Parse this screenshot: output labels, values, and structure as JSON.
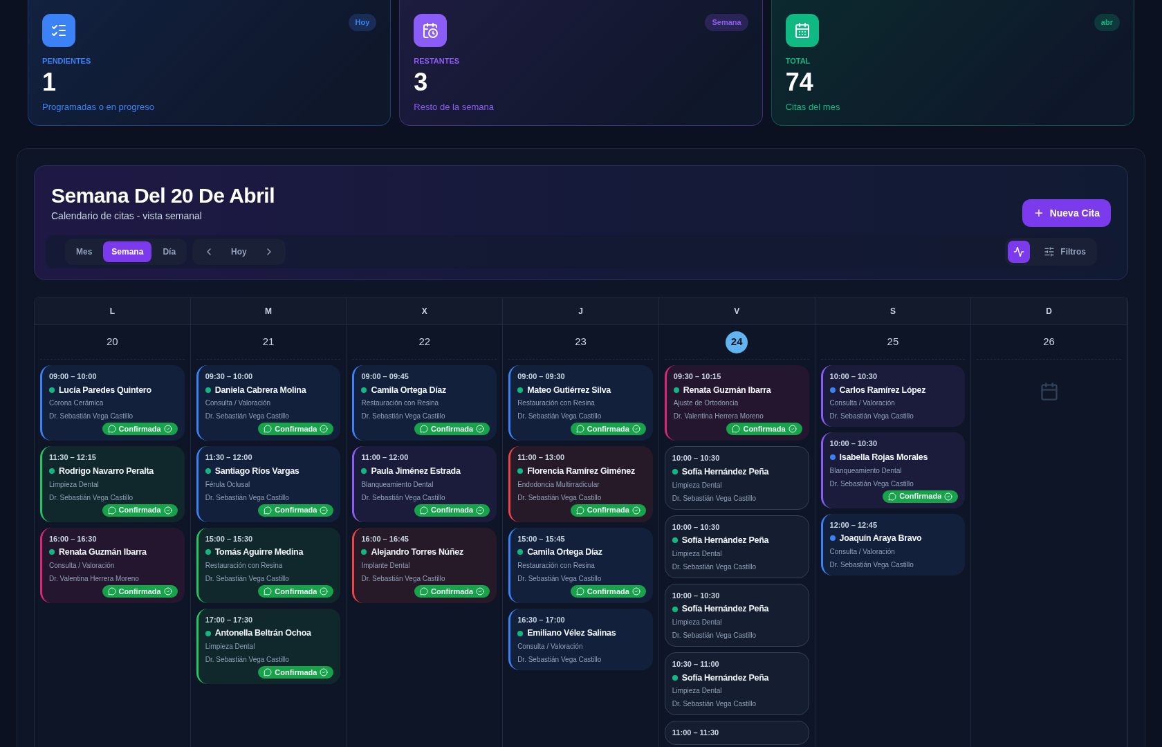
{
  "stats": [
    {
      "kind": "list",
      "badge": "Hoy",
      "label": "PENDIENTES",
      "value": "1",
      "caption": "Programadas o en progreso",
      "color": "#3b82f6"
    },
    {
      "kind": "clock",
      "badge": "Semana",
      "label": "RESTANTES",
      "value": "3",
      "caption": "Resto de la semana",
      "color": "#8b5cf6"
    },
    {
      "kind": "calendar",
      "badge": "abr",
      "label": "TOTAL",
      "value": "74",
      "caption": "Citas del mes",
      "color": "#10b981"
    }
  ],
  "header": {
    "title": "Semana Del 20 De Abril",
    "subtitle": "Calendario de citas - vista semanal",
    "new_button": "Nueva Cita",
    "views": [
      {
        "label": "Mes",
        "selected": false
      },
      {
        "label": "Semana",
        "selected": true
      },
      {
        "label": "Día",
        "selected": false
      }
    ],
    "today_button": "Hoy",
    "activity_on": true,
    "filters": "Filtros"
  },
  "days": [
    {
      "letter": "L",
      "date": "20",
      "selected": false,
      "appointments": [
        {
          "kind": "blue",
          "color": "#10b981",
          "time": "09:00 – 10:00",
          "patient": "Lucía Paredes Quintero",
          "treatment": "Corona Cerámica",
          "doctor": "Dr. Sebastián Vega Castillo",
          "status": "Confirmada"
        },
        {
          "kind": "green",
          "color": "#10b981",
          "time": "11:30 – 12:15",
          "patient": "Rodrigo Navarro Peralta",
          "treatment": "Limpieza Dental",
          "doctor": "Dr. Sebastián Vega Castillo",
          "status": "Confirmada"
        },
        {
          "kind": "pink",
          "color": "#10b981",
          "time": "16:00 – 16:30",
          "patient": "Renata Guzmán Ibarra",
          "treatment": "Consulta / Valoración",
          "doctor": "Dr. Valentina Herrera Moreno",
          "status": "Confirmada"
        }
      ]
    },
    {
      "letter": "M",
      "date": "21",
      "selected": false,
      "appointments": [
        {
          "kind": "blue",
          "color": "#10b981",
          "time": "09:30 – 10:00",
          "patient": "Daniela Cabrera Molina",
          "treatment": "Consulta / Valoración",
          "doctor": "Dr. Sebastián Vega Castillo",
          "status": "Confirmada"
        },
        {
          "kind": "blue",
          "color": "#10b981",
          "time": "11:30 – 12:00",
          "patient": "Santiago Ríos Vargas",
          "treatment": "Férula Oclusal",
          "doctor": "Dr. Sebastián Vega Castillo",
          "status": "Confirmada"
        },
        {
          "kind": "green",
          "color": "#10b981",
          "time": "15:00 – 15:30",
          "patient": "Tomás Aguirre Medina",
          "treatment": "Restauración con Resina",
          "doctor": "Dr. Sebastián Vega Castillo",
          "status": "Confirmada"
        },
        {
          "kind": "green",
          "color": "#10b981",
          "time": "17:00 – 17:30",
          "patient": "Antonella Beltrán Ochoa",
          "treatment": "Limpieza Dental",
          "doctor": "Dr. Sebastián Vega Castillo",
          "status": "Confirmada"
        }
      ]
    },
    {
      "letter": "X",
      "date": "22",
      "selected": false,
      "appointments": [
        {
          "kind": "blue",
          "color": "#10b981",
          "time": "09:00 – 09:45",
          "patient": "Camila Ortega Díaz",
          "treatment": "Restauración con Resina",
          "doctor": "Dr. Sebastián Vega Castillo",
          "status": "Confirmada"
        },
        {
          "kind": "purple",
          "color": "#10b981",
          "time": "11:00 – 12:00",
          "patient": "Paula Jiménez Estrada",
          "treatment": "Blanqueamiento Dental",
          "doctor": "Dr. Sebastián Vega Castillo",
          "status": "Confirmada"
        },
        {
          "kind": "red",
          "color": "#10b981",
          "time": "16:00 – 16:45",
          "patient": "Alejandro Torres Núñez",
          "treatment": "Implante Dental",
          "doctor": "Dr. Sebastián Vega Castillo",
          "status": "Confirmada"
        }
      ]
    },
    {
      "letter": "J",
      "date": "23",
      "selected": false,
      "appointments": [
        {
          "kind": "blue",
          "color": "#10b981",
          "time": "09:00 – 09:30",
          "patient": "Mateo Gutiérrez Silva",
          "treatment": "Restauración con Resina",
          "doctor": "Dr. Sebastián Vega Castillo",
          "status": "Confirmada"
        },
        {
          "kind": "red",
          "color": "#10b981",
          "time": "11:00 – 13:00",
          "patient": "Florencia Ramírez Giménez",
          "treatment": "Endodoncia Multirradicular",
          "doctor": "Dr. Sebastián Vega Castillo",
          "status": "Confirmada"
        },
        {
          "kind": "blue",
          "color": "#10b981",
          "time": "15:00 – 15:45",
          "patient": "Camila Ortega Díaz",
          "treatment": "Restauración con Resina",
          "doctor": "Dr. Sebastián Vega Castillo",
          "status": "Confirmada"
        },
        {
          "kind": "blue",
          "color": "#10b981",
          "time": "16:30 – 17:00",
          "patient": "Emiliano Vélez Salinas",
          "treatment": "Consulta / Valoración",
          "doctor": "Dr. Sebastián Vega Castillo"
        }
      ]
    },
    {
      "letter": "V",
      "date": "24",
      "selected": true,
      "appointments": [
        {
          "kind": "pink",
          "color": "#10b981",
          "time": "09:30 – 10:15",
          "patient": "Renata Guzmán Ibarra",
          "treatment": "Ajuste de Ortodoncia",
          "doctor": "Dr. Valentina Herrera Moreno",
          "status": "Confirmada"
        },
        {
          "kind": "plain",
          "color": "#10b981",
          "time": "10:00 – 10:30",
          "patient": "Sofía Hernández Peña",
          "treatment": "Limpieza Dental",
          "doctor": "Dr. Sebastián Vega Castillo"
        },
        {
          "kind": "plain",
          "color": "#10b981",
          "time": "10:00 – 10:30",
          "patient": "Sofía Hernández Peña",
          "treatment": "Limpieza Dental",
          "doctor": "Dr. Sebastián Vega Castillo"
        },
        {
          "kind": "plain",
          "color": "#10b981",
          "time": "10:00 – 10:30",
          "patient": "Sofía Hernández Peña",
          "treatment": "Limpieza Dental",
          "doctor": "Dr. Sebastián Vega Castillo"
        },
        {
          "kind": "plain",
          "color": "#10b981",
          "time": "10:30 – 11:00",
          "patient": "Sofía Hernández Peña",
          "treatment": "Limpieza Dental",
          "doctor": "Dr. Sebastián Vega Castillo"
        },
        {
          "kind": "plain",
          "time": "11:00 – 11:30"
        }
      ]
    },
    {
      "letter": "S",
      "date": "25",
      "selected": false,
      "appointments": [
        {
          "kind": "purple",
          "color": "#3b82f6",
          "time": "10:00 – 10:30",
          "patient": "Carlos Ramírez López",
          "treatment": "Consulta / Valoración",
          "doctor": "Dr. Sebastián Vega Castillo"
        },
        {
          "kind": "purple",
          "color": "#3b82f6",
          "time": "10:00 – 10:30",
          "patient": "Isabella Rojas Morales",
          "treatment": "Blanqueamiento Dental",
          "doctor": "Dr. Sebastián Vega Castillo",
          "status": "Confirmada"
        },
        {
          "kind": "blue",
          "color": "#3b82f6",
          "time": "12:00 – 12:45",
          "patient": "Joaquín Araya Bravo",
          "treatment": "Consulta / Valoración",
          "doctor": "Dr. Sebastián Vega Castillo"
        }
      ]
    },
    {
      "letter": "D",
      "date": "26",
      "selected": false
    }
  ]
}
